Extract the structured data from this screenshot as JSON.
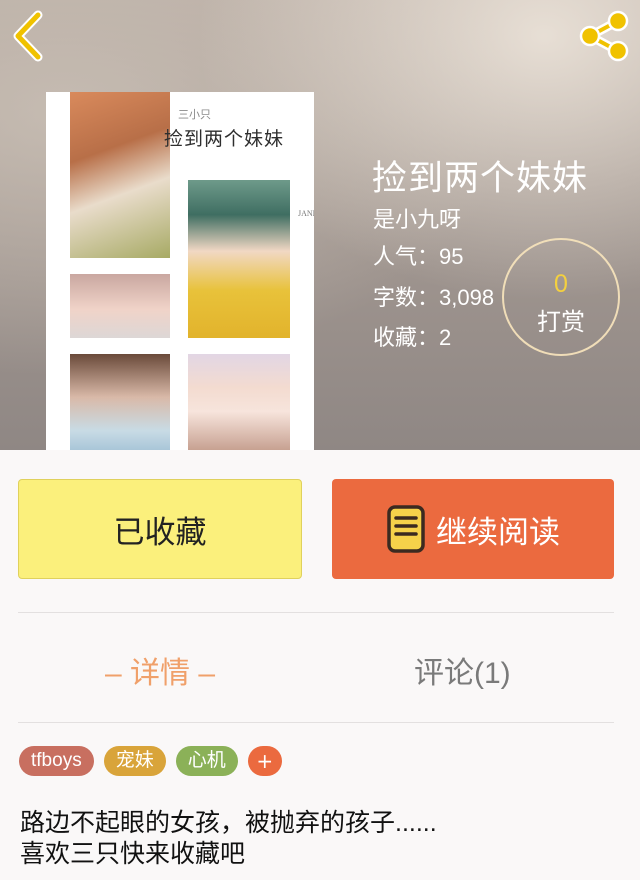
{
  "colors": {
    "accent_orange": "#eb6a3f",
    "favorite_yellow": "#fbf07c",
    "reward_count": "#f4d03f",
    "tab_active": "#f0a06a",
    "tab_inactive": "#7a7a7a"
  },
  "header": {
    "back_icon": "chevron-left-icon",
    "share_icon": "share-icon"
  },
  "cover": {
    "subtitle": "三小只",
    "title": "捡到两个妹妹",
    "side_text": "JANE"
  },
  "book": {
    "title": "捡到两个妹妹",
    "author": "是小九呀",
    "popularity": "人气：95",
    "word_count": "字数：3,098",
    "favorites": "收藏：2"
  },
  "reward": {
    "count": "0",
    "label": "打赏"
  },
  "actions": {
    "favorite_label": "已收藏",
    "read_label": "继续阅读",
    "read_icon": "book-icon"
  },
  "tabs": {
    "detail": "– 详情 –",
    "comments": "评论(1)"
  },
  "tags": [
    {
      "label": "tfboys",
      "color": "#c86f60"
    },
    {
      "label": "宠妹",
      "color": "#d9a43a"
    },
    {
      "label": "心机",
      "color": "#8bb158"
    }
  ],
  "tag_add": "+",
  "description": {
    "line1": "路边不起眼的女孩，被抛弃的孩子......",
    "line2": "喜欢三只快来收藏吧"
  }
}
